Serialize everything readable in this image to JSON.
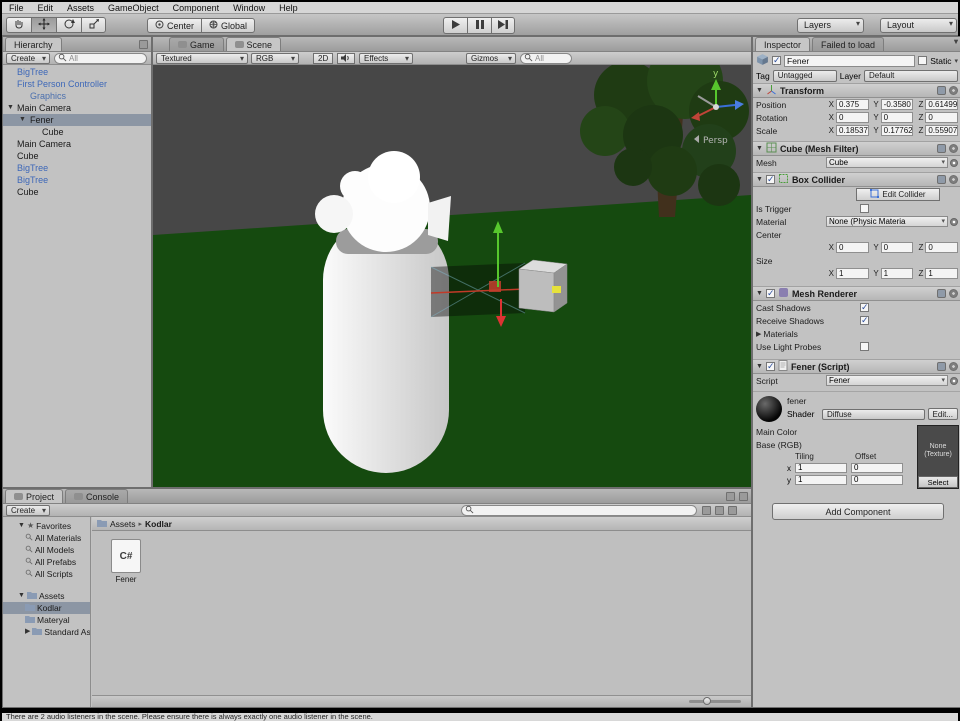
{
  "colors": {
    "prefab_text_blue": "#3e68b8",
    "selection_gray_blue": "#8c96a4",
    "scene_background": "#474747",
    "ground_green": "#154a0f",
    "checkmark_blue": "#2d4f9e",
    "gizmo_green": "#57c72d",
    "gizmo_red": "#dd3333",
    "gizmo_blue": "#3a6fd8"
  },
  "menu": {
    "items": [
      "File",
      "Edit",
      "Assets",
      "GameObject",
      "Component",
      "Window",
      "Help"
    ]
  },
  "toolbar": {
    "center": "Center",
    "global": "Global",
    "layers": "Layers",
    "layout": "Layout"
  },
  "hierarchy": {
    "tab": "Hierarchy",
    "create": "Create",
    "search_placeholder": "All",
    "items": [
      {
        "label": "BigTree"
      },
      {
        "label": "First Person Controller"
      },
      {
        "label": "Graphics"
      },
      {
        "label": "Main Camera"
      },
      {
        "label": "Fener"
      },
      {
        "label": "Cube"
      },
      {
        "label": "Main Camera"
      },
      {
        "label": "Cube"
      },
      {
        "label": "BigTree"
      },
      {
        "label": "BigTree"
      },
      {
        "label": "Cube"
      }
    ]
  },
  "scene": {
    "game_tab": "Game",
    "scene_tab": "Scene",
    "shading": "Textured",
    "channel": "RGB",
    "mode2d": "2D",
    "effects": "Effects",
    "gizmos": "Gizmos",
    "search_placeholder": "All",
    "axis_y": "y",
    "persp": "Persp"
  },
  "inspector": {
    "tab_inspector": "Inspector",
    "tab_failed": "Failed to load",
    "name": "Fener",
    "static": "Static",
    "tag_label": "Tag",
    "tag": "Untagged",
    "layer_label": "Layer",
    "layer": "Default",
    "axis": {
      "x": "X",
      "y": "Y",
      "z": "Z"
    },
    "transform": {
      "title": "Transform",
      "position_label": "Position",
      "rotation_label": "Rotation",
      "scale_label": "Scale",
      "position": {
        "x": "0.375",
        "y": "-0.3580",
        "z": "0.61499"
      },
      "rotation": {
        "x": "0",
        "y": "0",
        "z": "0"
      },
      "scale": {
        "x": "0.18537",
        "y": "0.17762",
        "z": "0.55907"
      }
    },
    "mesh_filter": {
      "title": "Cube (Mesh Filter)",
      "mesh_label": "Mesh",
      "mesh": "Cube"
    },
    "box_collider": {
      "title": "Box Collider",
      "edit_collider": "Edit Collider",
      "is_trigger_label": "Is Trigger",
      "material_label": "Material",
      "material": "None (Physic Materia",
      "center_label": "Center",
      "center": {
        "x": "0",
        "y": "0",
        "z": "0"
      },
      "size_label": "Size",
      "size": {
        "x": "1",
        "y": "1",
        "z": "1"
      }
    },
    "mesh_renderer": {
      "title": "Mesh Renderer",
      "cast_shadows": "Cast Shadows",
      "receive_shadows": "Receive Shadows",
      "materials": "Materials",
      "use_light_probes": "Use Light Probes"
    },
    "fener_script": {
      "title": "Fener (Script)",
      "script_label": "Script",
      "script": "Fener"
    },
    "material": {
      "name": "fener",
      "shader_label": "Shader",
      "shader": "Diffuse",
      "edit": "Edit...",
      "main_color": "Main Color",
      "base_rgb": "Base (RGB)",
      "tiling": "Tiling",
      "offset": "Offset",
      "x_label": "x",
      "y_label": "y",
      "tiling_x": "1",
      "offset_x": "0",
      "tiling_y": "1",
      "offset_y": "0",
      "none_line1": "None",
      "none_line2": "(Texture)",
      "select": "Select"
    },
    "add_component": "Add Component"
  },
  "project": {
    "tab_project": "Project",
    "tab_console": "Console",
    "create": "Create",
    "favorites": "Favorites",
    "fav_items": [
      "All Materials",
      "All Models",
      "All Prefabs",
      "All Scripts"
    ],
    "assets_label": "Assets",
    "folders": [
      "Kodlar",
      "Materyal",
      "Standard As"
    ],
    "breadcrumb_root": "Assets",
    "breadcrumb_current": "Kodlar",
    "file_name": "Fener",
    "file_icon_label": "C#"
  },
  "status": "There are 2 audio listeners in the scene. Please ensure there is always exactly one audio listener in the scene."
}
